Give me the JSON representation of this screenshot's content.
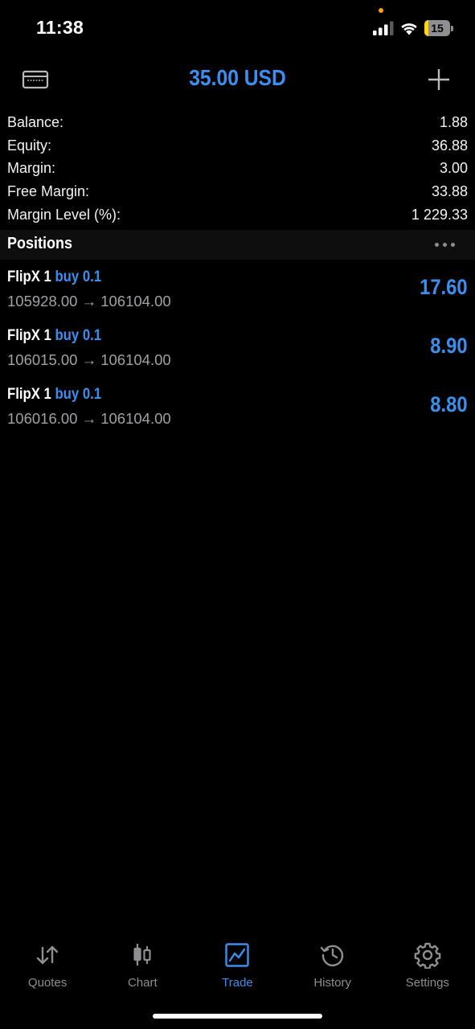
{
  "status_bar": {
    "time": "11:38",
    "battery_level": "15",
    "indicator_color": "#ff9f0a"
  },
  "header": {
    "title": "35.00 USD",
    "left_icon": "card-icon",
    "right_icon": "plus-icon",
    "accent_color": "#3a8ff0"
  },
  "summary": [
    {
      "label": "Balance:",
      "value": "1.88"
    },
    {
      "label": "Equity:",
      "value": "36.88"
    },
    {
      "label": "Margin:",
      "value": "3.00"
    },
    {
      "label": "Free Margin:",
      "value": "33.88"
    },
    {
      "label": "Margin Level (%):",
      "value": "1 229.33"
    }
  ],
  "positions": {
    "title": "Positions",
    "more_icon": "ellipsis-icon",
    "items": [
      {
        "symbol": "FlipX 1",
        "side": "buy 0.1",
        "open_price": "105928.00",
        "arrow": "→",
        "current_price": "106104.00",
        "profit": "17.60"
      },
      {
        "symbol": "FlipX 1",
        "side": "buy 0.1",
        "open_price": "106015.00",
        "arrow": "→",
        "current_price": "106104.00",
        "profit": "8.90"
      },
      {
        "symbol": "FlipX 1",
        "side": "buy 0.1",
        "open_price": "106016.00",
        "arrow": "→",
        "current_price": "106104.00",
        "profit": "8.80"
      }
    ]
  },
  "tabs": [
    {
      "label": "Quotes",
      "icon": "quotes-arrows-icon",
      "active": false
    },
    {
      "label": "Chart",
      "icon": "candlestick-icon",
      "active": false
    },
    {
      "label": "Trade",
      "icon": "trade-chart-icon",
      "active": true
    },
    {
      "label": "History",
      "icon": "history-clock-icon",
      "active": false
    },
    {
      "label": "Settings",
      "icon": "gear-icon",
      "active": false
    }
  ]
}
